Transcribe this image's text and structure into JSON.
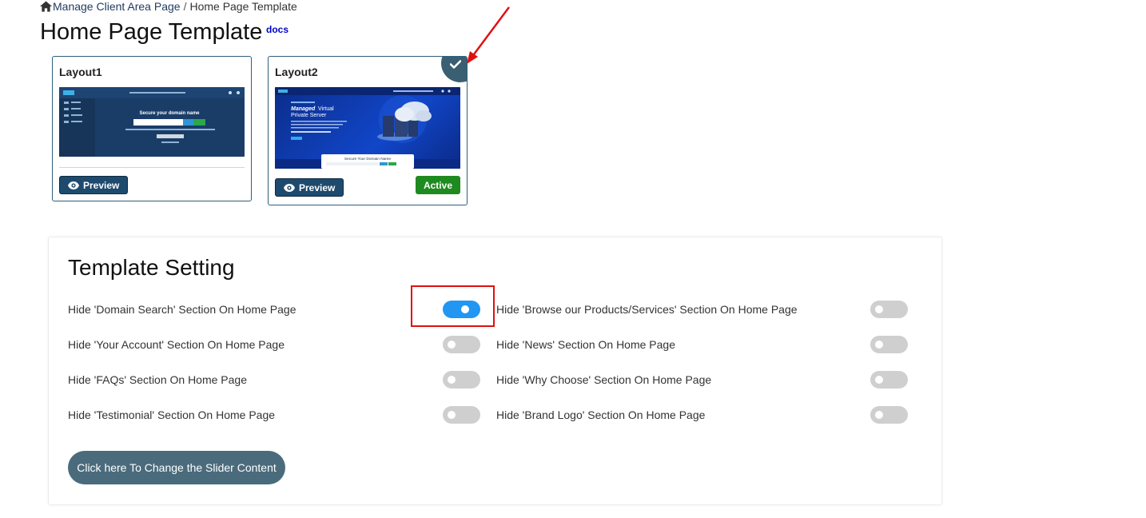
{
  "breadcrumb": {
    "parent_label": "Manage Client Area Page",
    "separator": "/",
    "current_label": "Home Page Template"
  },
  "page": {
    "title": "Home Page Template",
    "docs_label": "docs"
  },
  "layouts": [
    {
      "name": "Layout1",
      "preview_label": "Preview",
      "selected": false
    },
    {
      "name": "Layout2",
      "preview_label": "Preview",
      "selected": true,
      "status_label": "Active"
    }
  ],
  "thumb2": {
    "heading_em": "Managed",
    "heading_rest": "Virtual",
    "heading_line2": "Private Server",
    "search_title": "Secure Your Domain Name"
  },
  "thumb1": {
    "search_title": "Secure your domain name"
  },
  "template_setting": {
    "title": "Template Setting",
    "left": [
      {
        "label": "Hide 'Domain Search' Section On Home Page",
        "enabled": true
      },
      {
        "label": "Hide 'Your Account' Section On Home Page",
        "enabled": false
      },
      {
        "label": "Hide 'FAQs' Section On Home Page",
        "enabled": false
      },
      {
        "label": "Hide 'Testimonial' Section On Home Page",
        "enabled": false
      }
    ],
    "right": [
      {
        "label": "Hide 'Browse our Products/Services' Section On Home Page",
        "enabled": false
      },
      {
        "label": "Hide 'News' Section On Home Page",
        "enabled": false
      },
      {
        "label": "Hide 'Why Choose' Section On Home Page",
        "enabled": false
      },
      {
        "label": "Hide 'Brand Logo' Section On Home Page",
        "enabled": false
      }
    ],
    "slider_button_label": "Click here To Change the Slider Content"
  },
  "colors": {
    "toggle_on": "#2196f3",
    "toggle_off": "#cfcfcf",
    "active_badge": "#1f8a1f",
    "preview_button": "#1e4a6e",
    "annotation": "#e01010"
  }
}
